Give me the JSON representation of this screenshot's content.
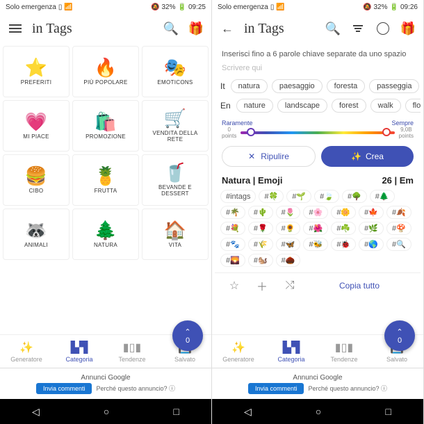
{
  "status": {
    "left": "Solo emergenza",
    "batt": "32%",
    "t1": "09:25",
    "t2": "09:26"
  },
  "app": {
    "title": "in Tags"
  },
  "grid": [
    {
      "ic": "⭐",
      "lbl": "PREFERITI"
    },
    {
      "ic": "🔥",
      "lbl": "PIÙ POPOLARE"
    },
    {
      "ic": "🎭",
      "lbl": "EMOTICONS"
    },
    {
      "ic": "💗",
      "lbl": "MI PIACE"
    },
    {
      "ic": "🛍️",
      "lbl": "PROMOZIONE"
    },
    {
      "ic": "🛒",
      "lbl": "VENDITA DELLA RETE"
    },
    {
      "ic": "🍔",
      "lbl": "CIBO"
    },
    {
      "ic": "🍍",
      "lbl": "FRUTTA"
    },
    {
      "ic": "🥤",
      "lbl": "BEVANDE E DESSERT"
    },
    {
      "ic": "🦝",
      "lbl": "ANIMALI"
    },
    {
      "ic": "🌲",
      "lbl": "NATURA"
    },
    {
      "ic": "🏠",
      "lbl": "VITA"
    }
  ],
  "fab": {
    "arrow": "⌃",
    "count": "0"
  },
  "nav": [
    {
      "ic": "✨",
      "lbl": "Generatore"
    },
    {
      "ic": "▙▜",
      "lbl": "Categoria"
    },
    {
      "ic": "▮▯▮",
      "lbl": "Tendenze"
    },
    {
      "ic": "💾",
      "lbl": "Salvato"
    }
  ],
  "ad": {
    "title": "Annunci Google",
    "btn": "Invia commenti",
    "q": "Perché questo annuncio? ⓘ"
  },
  "s2": {
    "instr": "Inserisci fino a 6 parole chiave separate da uno spazio",
    "placeholder": "Scrivere qui",
    "langIt": "It",
    "langEn": "En",
    "chipsIt": [
      "natura",
      "paesaggio",
      "foresta",
      "passeggia"
    ],
    "chipsEn": [
      "nature",
      "landscape",
      "forest",
      "walk",
      "flo"
    ],
    "slider": {
      "left": "Raramente",
      "right": "Sempre",
      "ptsL": "0",
      "ptsR": "9,0B",
      "ptsLabel": "points"
    },
    "clear": "Ripulire",
    "create": "Crea",
    "resultTitle": "Natura | Emoji",
    "resultCount": "26 | Em",
    "hashtag": "#intags",
    "emojis": [
      "🍀",
      "🌱",
      "🍃",
      "🌳",
      "🌲",
      "🌴",
      "🌵",
      "🌷",
      "🌸",
      "🌼",
      "🍁",
      "🍂",
      "💐",
      "🌹",
      "🌻",
      "🌺",
      "☘️",
      "🌿",
      "🍄",
      "🐾",
      "🌾",
      "🦋",
      "🐝",
      "🐞",
      "🌎",
      "🔍",
      "🌄",
      "🐿️",
      "🌰"
    ],
    "copy": "Copia tutto"
  }
}
